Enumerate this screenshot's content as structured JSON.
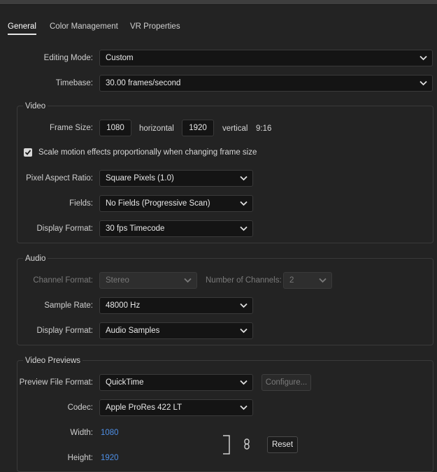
{
  "tabs": [
    "General",
    "Color Management",
    "VR Properties"
  ],
  "general": {
    "editing_mode": {
      "label": "Editing Mode:",
      "value": "Custom"
    },
    "timebase": {
      "label": "Timebase:",
      "value": "30.00  frames/second"
    }
  },
  "video": {
    "title": "Video",
    "frame_size_label": "Frame Size:",
    "width": "1080",
    "horizontal_label": "horizontal",
    "height": "1920",
    "vertical_label": "vertical",
    "aspect": "9:16",
    "scale_checkbox": {
      "label": "Scale motion effects proportionally when changing frame size",
      "checked": true
    },
    "pixel_aspect": {
      "label": "Pixel Aspect Ratio:",
      "value": "Square Pixels (1.0)"
    },
    "fields": {
      "label": "Fields:",
      "value": "No Fields (Progressive Scan)"
    },
    "display_format": {
      "label": "Display Format:",
      "value": "30 fps Timecode"
    }
  },
  "audio": {
    "title": "Audio",
    "channel_format": {
      "label": "Channel Format:",
      "value": "Stereo"
    },
    "num_channels": {
      "label": "Number of Channels:",
      "value": "2"
    },
    "sample_rate": {
      "label": "Sample Rate:",
      "value": "48000 Hz"
    },
    "display_format": {
      "label": "Display Format:",
      "value": "Audio Samples"
    }
  },
  "video_previews": {
    "title": "Video Previews",
    "preview_format": {
      "label": "Preview File Format:",
      "value": "QuickTime"
    },
    "configure_label": "Configure...",
    "codec": {
      "label": "Codec:",
      "value": "Apple ProRes 422 LT"
    },
    "width": {
      "label": "Width:",
      "value": "1080"
    },
    "height": {
      "label": "Height:",
      "value": "1920"
    },
    "reset_label": "Reset"
  },
  "colors": {
    "accent_blue": "#4e8fe6",
    "background": "#232323"
  },
  "icons": [
    "chevron-down-icon",
    "checkmark-icon",
    "link-icon",
    "bracket-icon"
  ]
}
